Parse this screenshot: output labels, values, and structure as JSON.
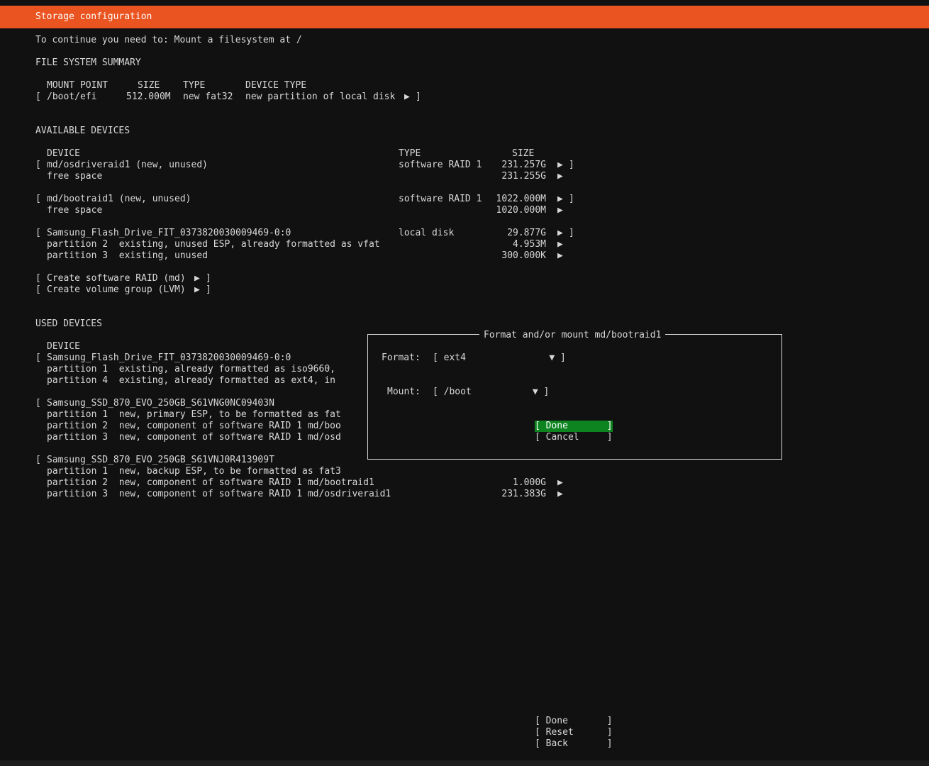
{
  "header": {
    "title": "Storage configuration"
  },
  "notice": "To continue you need to: Mount a filesystem at /",
  "fs_summary": {
    "heading": "FILE SYSTEM SUMMARY",
    "columns": {
      "mount": "MOUNT POINT",
      "size": "SIZE",
      "type": "TYPE",
      "device_type": "DEVICE TYPE"
    },
    "rows": [
      {
        "open": "[",
        "mount": "/boot/efi",
        "size": "512.000M",
        "type": "new fat32",
        "device_type": "new partition of local disk",
        "arrow": "▶",
        "close": "]"
      }
    ]
  },
  "available": {
    "heading": "AVAILABLE DEVICES",
    "columns": {
      "device": "DEVICE",
      "type": "TYPE",
      "size": "SIZE"
    },
    "devices": [
      {
        "open": "[",
        "name": "md/osdriveraid1 (new, unused)",
        "type": "software RAID 1",
        "size": "231.257G",
        "arrow": "▶",
        "close": "]"
      },
      {
        "name": "free space",
        "size": "231.255G",
        "arrow": "▶"
      },
      {
        "open": "[",
        "name": "md/bootraid1 (new, unused)",
        "type": "software RAID 1",
        "size": "1022.000M",
        "arrow": "▶",
        "close": "]"
      },
      {
        "name": "free space",
        "size": "1020.000M",
        "arrow": "▶"
      },
      {
        "open": "[",
        "name": "Samsung_Flash_Drive_FIT_0373820030009469-0:0",
        "type": "local disk",
        "size": "29.877G",
        "arrow": "▶",
        "close": "]"
      },
      {
        "name": "partition 2  existing, unused ESP, already formatted as vfat",
        "size": "4.953M",
        "arrow": "▶"
      },
      {
        "name": "partition 3  existing, unused",
        "size": "300.000K",
        "arrow": "▶"
      }
    ],
    "actions": [
      {
        "open": "[",
        "label": "Create software RAID (md)",
        "arrow": "▶",
        "close": "]"
      },
      {
        "open": "[",
        "label": "Create volume group (LVM)",
        "arrow": "▶",
        "close": "]"
      }
    ]
  },
  "used": {
    "heading": "USED DEVICES",
    "columns": {
      "device": "DEVICE"
    },
    "rows": [
      {
        "open": "[",
        "name": "Samsung_Flash_Drive_FIT_0373820030009469-0:0"
      },
      {
        "name": "partition 1  existing, already formatted as iso9660,"
      },
      {
        "name": "partition 4  existing, already formatted as ext4, in"
      },
      {
        "open": "[",
        "name": "Samsung_SSD_870_EVO_250GB_S61VNG0NC09403N"
      },
      {
        "name": "partition 1  new, primary ESP, to be formatted as fat"
      },
      {
        "name": "partition 2  new, component of software RAID 1 md/boo"
      },
      {
        "name": "partition 3  new, component of software RAID 1 md/osd"
      },
      {
        "open": "[",
        "name": "Samsung_SSD_870_EVO_250GB_S61VNJ0R413909T"
      },
      {
        "name": "partition 1  new, backup ESP, to be formatted as fat3"
      },
      {
        "name": "partition 2  new, component of software RAID 1 md/bootraid1",
        "size": "1.000G",
        "arrow": "▶"
      },
      {
        "name": "partition 3  new, component of software RAID 1 md/osdriveraid1",
        "size": "231.383G",
        "arrow": "▶"
      }
    ]
  },
  "dialog": {
    "title": "Format and/or mount md/bootraid1",
    "format_label": "Format:",
    "format_value": "[ ext4               ▼ ]",
    "mount_label": "Mount:",
    "mount_value": "[ /boot           ▼ ]",
    "done_label": "[ Done       ]",
    "cancel_label": "[ Cancel     ]"
  },
  "footer": {
    "done_label": "[ Done       ]",
    "reset_label": "[ Reset      ]",
    "back_label": "[ Back       ]"
  },
  "colors": {
    "accent": "#e95420",
    "focus": "#0e8420",
    "background": "#111111",
    "text": "#d8d8d8"
  }
}
